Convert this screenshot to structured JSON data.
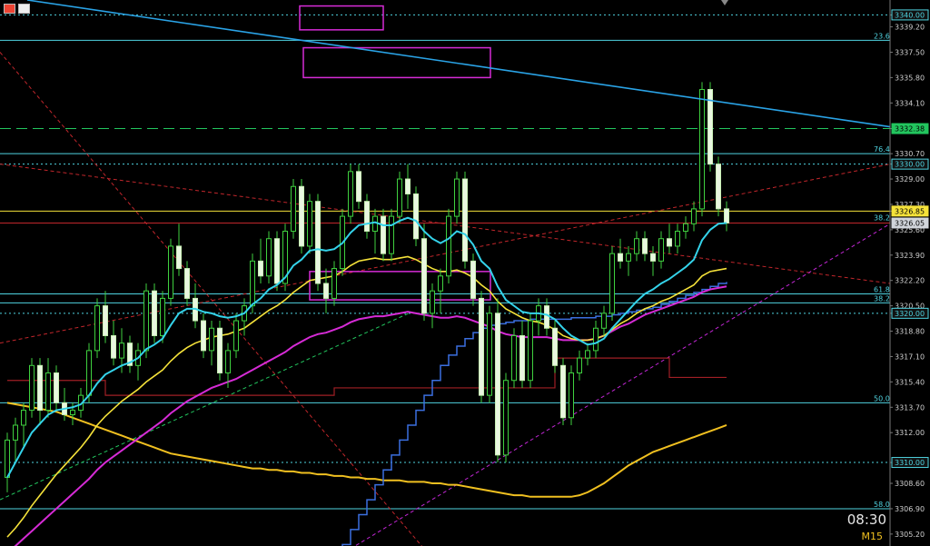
{
  "chart_data": {
    "type": "candlestick",
    "timeframe": "M15",
    "clock": "08:30",
    "ylim": [
      3304.4,
      3341.0
    ],
    "y_ticks": [
      3340.0,
      3339.2,
      3337.5,
      3335.8,
      3334.1,
      3332.38,
      3330.7,
      3330.0,
      3329.0,
      3327.3,
      3326.85,
      3325.6,
      3323.9,
      3322.2,
      3320.5,
      3320.0,
      3318.8,
      3317.1,
      3315.4,
      3313.7,
      3312.0,
      3310.0,
      3308.6,
      3306.9,
      3305.2
    ],
    "price_tags": [
      {
        "value": 3340.0,
        "label": "3340.00",
        "bg": "#111111",
        "fg": "#4fd3e0",
        "border": "#4fd3e0"
      },
      {
        "value": 3332.38,
        "label": "3332.38",
        "bg": "#22c55e",
        "fg": "#000000",
        "border": "#22c55e"
      },
      {
        "value": 3330.0,
        "label": "3330.00",
        "bg": "#111111",
        "fg": "#4fd3e0",
        "border": "#4fd3e0"
      },
      {
        "value": 3326.85,
        "label": "3326.85",
        "bg": "#f5e23a",
        "fg": "#000000",
        "border": "#f5e23a"
      },
      {
        "value": 3326.05,
        "label": "3326.05",
        "bg": "#d1d5db",
        "fg": "#000000",
        "border": "#d1d5db"
      },
      {
        "value": 3320.0,
        "label": "3320.00",
        "bg": "#111111",
        "fg": "#4fd3e0",
        "border": "#4fd3e0"
      },
      {
        "value": 3310.0,
        "label": "3310.00",
        "bg": "#111111",
        "fg": "#4fd3e0",
        "border": "#4fd3e0"
      }
    ],
    "fib_levels": [
      {
        "label": "23.6",
        "value": 3338.3
      },
      {
        "label": "76.4",
        "value": 3330.7
      },
      {
        "label": "38.2",
        "value": 3326.1
      },
      {
        "label": "61.8",
        "value": 3321.3
      },
      {
        "label": "38.2",
        "value": 3320.7
      },
      {
        "label": "50.0",
        "value": 3314.0
      },
      {
        "label": "58.0",
        "value": 3306.9
      }
    ],
    "hlines": [
      {
        "value": 3340.0,
        "color": "#4fd3e0",
        "dash": "2,3"
      },
      {
        "value": 3338.3,
        "color": "#4fd3e0",
        "dash": ""
      },
      {
        "value": 3332.38,
        "color": "#22c55e",
        "dash": "12,6"
      },
      {
        "value": 3330.7,
        "color": "#4fd3e0",
        "dash": ""
      },
      {
        "value": 3330.0,
        "color": "#4fd3e0",
        "dash": "2,3"
      },
      {
        "value": 3326.85,
        "color": "#f5e23a",
        "dash": ""
      },
      {
        "value": 3326.05,
        "color": "#c0262b",
        "dash": ""
      },
      {
        "value": 3321.3,
        "color": "#4fd3e0",
        "dash": ""
      },
      {
        "value": 3320.7,
        "color": "#4fd3e0",
        "dash": ""
      },
      {
        "value": 3320.0,
        "color": "#4fd3e0",
        "dash": "2,3"
      },
      {
        "value": 3314.0,
        "color": "#4fd3e0",
        "dash": ""
      },
      {
        "value": 3310.0,
        "color": "#4fd3e0",
        "dash": "2,3"
      },
      {
        "value": 3306.9,
        "color": "#4fd3e0",
        "dash": ""
      }
    ],
    "zones": [
      {
        "i0": 46,
        "i1": 330,
        "y0": 3340.6,
        "y1": 3339.0,
        "color": "#d62bd6"
      },
      {
        "i0": 334,
        "i1": 540,
        "y0": 3337.8,
        "y1": 3335.8,
        "color": "#d62bd6"
      },
      {
        "i0": 341,
        "i1": 540,
        "y0": 3322.8,
        "y1": 3320.9,
        "color": "#d62bd6"
      }
    ],
    "candles": [
      [
        3309.0,
        3312.0,
        3308.0,
        3311.5
      ],
      [
        3311.5,
        3313.0,
        3310.0,
        3312.5
      ],
      [
        3312.5,
        3314.0,
        3311.0,
        3313.5
      ],
      [
        3313.5,
        3317.0,
        3313.0,
        3316.5
      ],
      [
        3316.5,
        3317.0,
        3312.5,
        3313.5
      ],
      [
        3313.5,
        3317.0,
        3313.0,
        3316.0
      ],
      [
        3316.0,
        3316.5,
        3313.5,
        3314.0
      ],
      [
        3314.0,
        3315.0,
        3312.8,
        3313.2
      ],
      [
        3313.2,
        3314.0,
        3312.5,
        3313.5
      ],
      [
        3313.5,
        3315.0,
        3313.0,
        3314.5
      ],
      [
        3314.5,
        3318.0,
        3314.0,
        3317.5
      ],
      [
        3317.5,
        3321.0,
        3317.0,
        3320.5
      ],
      [
        3320.5,
        3321.5,
        3318.0,
        3318.5
      ],
      [
        3318.5,
        3319.5,
        3316.5,
        3317.0
      ],
      [
        3317.0,
        3319.0,
        3316.0,
        3318.0
      ],
      [
        3318.0,
        3318.5,
        3316.0,
        3316.5
      ],
      [
        3316.5,
        3318.0,
        3315.5,
        3317.5
      ],
      [
        3317.5,
        3322.0,
        3317.0,
        3321.5
      ],
      [
        3321.5,
        3322.0,
        3318.0,
        3318.5
      ],
      [
        3318.5,
        3321.5,
        3318.0,
        3321.0
      ],
      [
        3321.0,
        3325.0,
        3320.5,
        3324.5
      ],
      [
        3324.5,
        3326.0,
        3322.5,
        3323.0
      ],
      [
        3323.0,
        3323.5,
        3320.5,
        3321.0
      ],
      [
        3321.0,
        3322.0,
        3319.0,
        3319.5
      ],
      [
        3319.5,
        3320.0,
        3317.0,
        3317.5
      ],
      [
        3317.5,
        3319.5,
        3316.5,
        3319.0
      ],
      [
        3319.0,
        3319.5,
        3315.5,
        3316.0
      ],
      [
        3316.0,
        3318.0,
        3315.0,
        3317.5
      ],
      [
        3317.5,
        3320.0,
        3317.0,
        3319.5
      ],
      [
        3319.5,
        3321.0,
        3318.5,
        3320.5
      ],
      [
        3320.5,
        3324.0,
        3320.0,
        3323.5
      ],
      [
        3323.5,
        3325.0,
        3322.0,
        3322.5
      ],
      [
        3322.5,
        3325.5,
        3322.0,
        3325.0
      ],
      [
        3325.0,
        3325.5,
        3321.5,
        3322.0
      ],
      [
        3322.0,
        3326.0,
        3321.5,
        3325.5
      ],
      [
        3325.5,
        3329.0,
        3325.0,
        3328.5
      ],
      [
        3328.5,
        3329.0,
        3324.0,
        3324.5
      ],
      [
        3324.5,
        3328.0,
        3324.0,
        3327.5
      ],
      [
        3327.5,
        3328.0,
        3321.5,
        3322.0
      ],
      [
        3322.0,
        3323.0,
        3320.0,
        3321.0
      ],
      [
        3321.0,
        3323.5,
        3320.5,
        3323.0
      ],
      [
        3323.0,
        3327.0,
        3322.5,
        3326.5
      ],
      [
        3326.5,
        3330.0,
        3326.0,
        3329.5
      ],
      [
        3329.5,
        3330.0,
        3327.0,
        3327.5
      ],
      [
        3327.5,
        3328.0,
        3325.0,
        3325.5
      ],
      [
        3325.5,
        3327.0,
        3324.0,
        3326.5
      ],
      [
        3326.5,
        3327.0,
        3323.5,
        3324.0
      ],
      [
        3324.0,
        3327.0,
        3323.5,
        3326.5
      ],
      [
        3326.5,
        3329.5,
        3326.0,
        3329.0
      ],
      [
        3329.0,
        3330.0,
        3327.0,
        3328.0
      ],
      [
        3328.0,
        3328.5,
        3324.5,
        3325.0
      ],
      [
        3325.0,
        3326.0,
        3319.5,
        3320.0
      ],
      [
        3320.0,
        3322.0,
        3319.0,
        3321.5
      ],
      [
        3321.5,
        3323.0,
        3320.0,
        3322.5
      ],
      [
        3322.5,
        3327.0,
        3322.0,
        3326.5
      ],
      [
        3326.5,
        3329.5,
        3326.0,
        3329.0
      ],
      [
        3329.0,
        3329.5,
        3323.0,
        3323.5
      ],
      [
        3323.5,
        3324.0,
        3320.5,
        3321.0
      ],
      [
        3321.0,
        3321.5,
        3314.0,
        3314.5
      ],
      [
        3314.5,
        3320.5,
        3314.0,
        3320.0
      ],
      [
        3320.0,
        3321.0,
        3310.0,
        3310.5
      ],
      [
        3310.5,
        3316.0,
        3310.0,
        3315.5
      ],
      [
        3315.5,
        3319.0,
        3315.0,
        3318.5
      ],
      [
        3318.5,
        3319.5,
        3315.0,
        3315.5
      ],
      [
        3315.5,
        3320.0,
        3315.0,
        3319.5
      ],
      [
        3319.5,
        3321.0,
        3318.5,
        3320.5
      ],
      [
        3320.5,
        3321.0,
        3318.5,
        3319.0
      ],
      [
        3319.0,
        3319.5,
        3316.0,
        3316.5
      ],
      [
        3316.5,
        3317.0,
        3312.5,
        3313.0
      ],
      [
        3313.0,
        3316.5,
        3312.5,
        3316.0
      ],
      [
        3316.0,
        3317.5,
        3315.5,
        3317.0
      ],
      [
        3317.0,
        3318.0,
        3316.5,
        3317.5
      ],
      [
        3317.5,
        3319.5,
        3317.0,
        3319.0
      ],
      [
        3319.0,
        3320.5,
        3318.5,
        3320.0
      ],
      [
        3320.0,
        3324.5,
        3319.5,
        3324.0
      ],
      [
        3324.0,
        3325.0,
        3323.0,
        3323.5
      ],
      [
        3323.5,
        3324.5,
        3322.5,
        3324.0
      ],
      [
        3324.0,
        3325.5,
        3323.5,
        3325.0
      ],
      [
        3325.0,
        3325.5,
        3323.5,
        3324.0
      ],
      [
        3324.0,
        3324.5,
        3322.5,
        3323.5
      ],
      [
        3323.5,
        3325.5,
        3323.0,
        3325.0
      ],
      [
        3325.0,
        3326.0,
        3324.0,
        3324.5
      ],
      [
        3324.5,
        3326.0,
        3324.0,
        3325.5
      ],
      [
        3325.5,
        3326.5,
        3325.0,
        3326.0
      ],
      [
        3326.0,
        3327.5,
        3325.5,
        3327.0
      ],
      [
        3327.0,
        3335.5,
        3326.5,
        3335.0
      ],
      [
        3335.0,
        3335.5,
        3329.5,
        3330.0
      ],
      [
        3330.0,
        3330.5,
        3326.5,
        3327.0
      ],
      [
        3327.0,
        3327.5,
        3325.5,
        3326.05
      ]
    ],
    "ma_cyan": [
      3309.0,
      3310.0,
      3311.0,
      3312.0,
      3312.6,
      3313.2,
      3313.5,
      3313.6,
      3313.7,
      3313.9,
      3314.5,
      3315.3,
      3315.9,
      3316.2,
      3316.5,
      3316.7,
      3317.0,
      3317.6,
      3317.9,
      3318.3,
      3319.2,
      3320.0,
      3320.3,
      3320.3,
      3320.1,
      3320.0,
      3319.8,
      3319.7,
      3319.8,
      3320.0,
      3320.6,
      3321.0,
      3321.6,
      3321.9,
      3322.4,
      3323.2,
      3323.6,
      3324.2,
      3324.3,
      3324.2,
      3324.3,
      3324.7,
      3325.4,
      3325.9,
      3326.0,
      3326.1,
      3325.9,
      3325.9,
      3326.2,
      3326.4,
      3326.2,
      3325.5,
      3325.0,
      3324.7,
      3325.0,
      3325.5,
      3325.3,
      3324.6,
      3323.5,
      3323.0,
      3321.8,
      3320.9,
      3320.5,
      3320.1,
      3320.0,
      3320.0,
      3319.9,
      3319.6,
      3319.0,
      3318.5,
      3318.2,
      3317.9,
      3318.0,
      3318.3,
      3319.0,
      3319.6,
      3320.2,
      3320.8,
      3321.3,
      3321.6,
      3322.0,
      3322.3,
      3322.7,
      3323.1,
      3323.6,
      3324.9,
      3325.6,
      3326.0,
      3326.05
    ],
    "ma_yellow": [
      3305.0,
      3305.6,
      3306.3,
      3307.1,
      3307.8,
      3308.5,
      3309.2,
      3309.8,
      3310.4,
      3311.0,
      3311.7,
      3312.5,
      3313.1,
      3313.6,
      3314.1,
      3314.5,
      3314.9,
      3315.4,
      3315.8,
      3316.2,
      3316.8,
      3317.3,
      3317.7,
      3318.0,
      3318.2,
      3318.4,
      3318.5,
      3318.6,
      3318.8,
      3319.0,
      3319.4,
      3319.8,
      3320.2,
      3320.5,
      3320.9,
      3321.4,
      3321.8,
      3322.2,
      3322.3,
      3322.4,
      3322.5,
      3322.8,
      3323.2,
      3323.5,
      3323.6,
      3323.7,
      3323.6,
      3323.6,
      3323.7,
      3323.8,
      3323.6,
      3323.3,
      3323.0,
      3322.8,
      3322.8,
      3322.9,
      3322.7,
      3322.4,
      3321.9,
      3321.5,
      3320.8,
      3320.3,
      3320.0,
      3319.7,
      3319.5,
      3319.4,
      3319.2,
      3318.9,
      3318.5,
      3318.3,
      3318.2,
      3318.2,
      3318.3,
      3318.5,
      3318.9,
      3319.3,
      3319.6,
      3320.0,
      3320.3,
      3320.5,
      3320.8,
      3321.0,
      3321.3,
      3321.6,
      3321.9,
      3322.5,
      3322.8,
      3322.9,
      3323.0
    ],
    "ma_magenta": [
      3304.0,
      3304.4,
      3304.9,
      3305.4,
      3305.9,
      3306.4,
      3306.9,
      3307.4,
      3307.9,
      3308.4,
      3308.9,
      3309.5,
      3310.0,
      3310.4,
      3310.8,
      3311.2,
      3311.6,
      3312.0,
      3312.4,
      3312.8,
      3313.3,
      3313.7,
      3314.1,
      3314.4,
      3314.7,
      3315.0,
      3315.2,
      3315.4,
      3315.6,
      3315.9,
      3316.2,
      3316.5,
      3316.8,
      3317.1,
      3317.4,
      3317.8,
      3318.1,
      3318.4,
      3318.6,
      3318.7,
      3318.9,
      3319.1,
      3319.4,
      3319.6,
      3319.7,
      3319.8,
      3319.8,
      3319.9,
      3320.0,
      3320.1,
      3320.0,
      3319.9,
      3319.8,
      3319.7,
      3319.7,
      3319.8,
      3319.7,
      3319.5,
      3319.3,
      3319.1,
      3318.8,
      3318.6,
      3318.5,
      3318.4,
      3318.4,
      3318.4,
      3318.4,
      3318.3,
      3318.2,
      3318.2,
      3318.2,
      3318.2,
      3318.3,
      3318.5,
      3318.8,
      3319.1,
      3319.3,
      3319.6,
      3319.9,
      3320.1,
      3320.3,
      3320.5,
      3320.7,
      3320.9,
      3321.1,
      3321.4,
      3321.6,
      3321.7,
      3321.8
    ],
    "ma_blue_stepped": [
      3303.0,
      3303.0,
      3303.0,
      3303.0,
      3303.0,
      3303.0,
      3303.0,
      3303.0,
      3303.0,
      3303.0,
      3303.0,
      3303.0,
      3303.0,
      3303.0,
      3303.0,
      3303.0,
      3303.0,
      3303.0,
      3303.0,
      3303.0,
      3303.0,
      3303.0,
      3303.0,
      3303.0,
      3303.0,
      3303.0,
      3303.0,
      3303.0,
      3303.0,
      3303.0,
      3303.0,
      3303.0,
      3303.0,
      3303.0,
      3303.0,
      3303.0,
      3303.0,
      3303.0,
      3303.0,
      3303.0,
      3303.5,
      3304.5,
      3305.5,
      3306.5,
      3307.5,
      3308.5,
      3309.5,
      3310.5,
      3311.5,
      3312.5,
      3313.5,
      3314.5,
      3315.5,
      3316.5,
      3317.2,
      3317.8,
      3318.3,
      3318.7,
      3319.0,
      3319.2,
      3319.3,
      3319.4,
      3319.5,
      3319.5,
      3319.6,
      3319.6,
      3319.6,
      3319.6,
      3319.6,
      3319.7,
      3319.7,
      3319.7,
      3319.8,
      3319.8,
      3319.9,
      3320.0,
      3320.1,
      3320.2,
      3320.3,
      3320.4,
      3320.6,
      3320.8,
      3321.0,
      3321.2,
      3321.4,
      3321.6,
      3321.8,
      3322.0,
      3322.1
    ],
    "ma_darkred_stepped": [
      3315.5,
      3315.5,
      3315.5,
      3315.5,
      3315.5,
      3315.5,
      3315.5,
      3315.5,
      3315.5,
      3315.5,
      3315.5,
      3315.5,
      3314.5,
      3314.5,
      3314.5,
      3314.5,
      3314.5,
      3314.5,
      3314.5,
      3314.5,
      3314.5,
      3314.5,
      3314.5,
      3314.5,
      3314.5,
      3314.5,
      3314.5,
      3314.5,
      3314.5,
      3314.5,
      3314.5,
      3314.5,
      3314.5,
      3314.5,
      3314.5,
      3314.5,
      3314.5,
      3314.5,
      3314.5,
      3314.5,
      3315.0,
      3315.0,
      3315.0,
      3315.0,
      3315.0,
      3315.0,
      3315.0,
      3315.0,
      3315.0,
      3315.0,
      3315.0,
      3315.0,
      3315.0,
      3315.0,
      3315.0,
      3315.0,
      3315.0,
      3315.0,
      3315.0,
      3315.0,
      3315.0,
      3315.0,
      3315.0,
      3315.0,
      3315.0,
      3315.0,
      3315.0,
      3317.0,
      3317.0,
      3317.0,
      3317.0,
      3317.0,
      3317.0,
      3317.0,
      3317.0,
      3317.0,
      3317.0,
      3317.0,
      3317.0,
      3317.0,
      3317.0,
      3315.7,
      3315.7,
      3315.7,
      3315.7,
      3315.7,
      3315.7,
      3315.7,
      3315.7
    ],
    "ma_yellow_slow": [
      3314.0,
      3313.9,
      3313.8,
      3313.7,
      3313.6,
      3313.5,
      3313.4,
      3313.2,
      3313.0,
      3312.8,
      3312.6,
      3312.4,
      3312.2,
      3312.0,
      3311.8,
      3311.6,
      3311.4,
      3311.2,
      3311.0,
      3310.8,
      3310.6,
      3310.5,
      3310.4,
      3310.3,
      3310.2,
      3310.1,
      3310.0,
      3309.9,
      3309.8,
      3309.7,
      3309.6,
      3309.6,
      3309.5,
      3309.5,
      3309.4,
      3309.4,
      3309.3,
      3309.3,
      3309.2,
      3309.2,
      3309.1,
      3309.1,
      3309.0,
      3309.0,
      3308.9,
      3308.9,
      3308.8,
      3308.8,
      3308.8,
      3308.7,
      3308.7,
      3308.7,
      3308.6,
      3308.6,
      3308.5,
      3308.5,
      3308.4,
      3308.3,
      3308.2,
      3308.1,
      3308.0,
      3307.9,
      3307.8,
      3307.8,
      3307.7,
      3307.7,
      3307.7,
      3307.7,
      3307.7,
      3307.7,
      3307.8,
      3308.0,
      3308.3,
      3308.6,
      3309.0,
      3309.4,
      3309.8,
      3310.1,
      3310.4,
      3310.7,
      3310.9,
      3311.1,
      3311.3,
      3311.5,
      3311.7,
      3311.9,
      3312.1,
      3312.3,
      3312.5
    ],
    "trendline_descending": {
      "x0": 30,
      "p0": 3341.0,
      "x1": 980,
      "p1": 3332.5,
      "color": "#2aa3e6"
    },
    "dashed_diagonals": [
      {
        "x0": 0,
        "p0": 3318.0,
        "x1": 980,
        "p1": 3330.0,
        "color": "#c0262b"
      },
      {
        "x0": 0,
        "p0": 3330.0,
        "x1": 980,
        "p1": 3322.0,
        "color": "#c0262b"
      },
      {
        "x0": 0,
        "p0": 3337.5,
        "x1": 470,
        "p1": 3304.0,
        "color": "#c0262b"
      },
      {
        "x0": 0,
        "p0": 3307.5,
        "x1": 450,
        "p1": 3320.0,
        "color": "#22c55e"
      },
      {
        "x0": 380,
        "p0": 3304.0,
        "x1": 980,
        "p1": 3326.0,
        "color": "#c026d3"
      }
    ]
  },
  "ui": {
    "clock": "08:30",
    "timeframe": "M15"
  }
}
